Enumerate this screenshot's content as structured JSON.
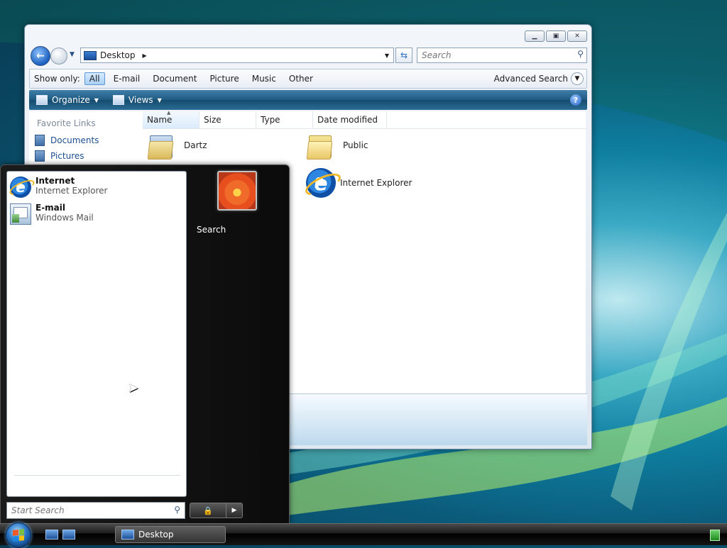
{
  "explorer": {
    "address": {
      "location": "Desktop"
    },
    "search_placeholder": "Search",
    "filter": {
      "label": "Show only:",
      "options": [
        "All",
        "E-mail",
        "Document",
        "Picture",
        "Music",
        "Other"
      ],
      "active": "All",
      "advanced_search": "Advanced Search"
    },
    "toolbar": {
      "organize": "Organize",
      "views": "Views",
      "help": "?"
    },
    "favorite_links": {
      "heading": "Favorite Links",
      "items": [
        "Documents",
        "Pictures"
      ]
    },
    "columns": [
      "Name",
      "Size",
      "Type",
      "Date modified"
    ],
    "items": [
      {
        "name": "Dartz",
        "icon": "user-folder-icon"
      },
      {
        "name": "Public",
        "icon": "folder-icon"
      },
      {
        "name": "Internet Explorer",
        "icon": "internet-explorer-icon"
      }
    ]
  },
  "start_menu": {
    "pinned": [
      {
        "title": "Internet",
        "subtitle": "Internet Explorer",
        "icon": "internet-explorer-icon"
      },
      {
        "title": "E-mail",
        "subtitle": "Windows Mail",
        "icon": "windows-mail-icon"
      }
    ],
    "right_links": [
      "Search"
    ],
    "search_placeholder": "Start Search"
  },
  "taskbar": {
    "tasks": [
      {
        "label": "Desktop"
      }
    ]
  },
  "colors": {
    "toolbar": "#1d5a82",
    "start_menu": "#0b0b0b",
    "taskbar": "#000000",
    "accent": "#1d4f91"
  }
}
